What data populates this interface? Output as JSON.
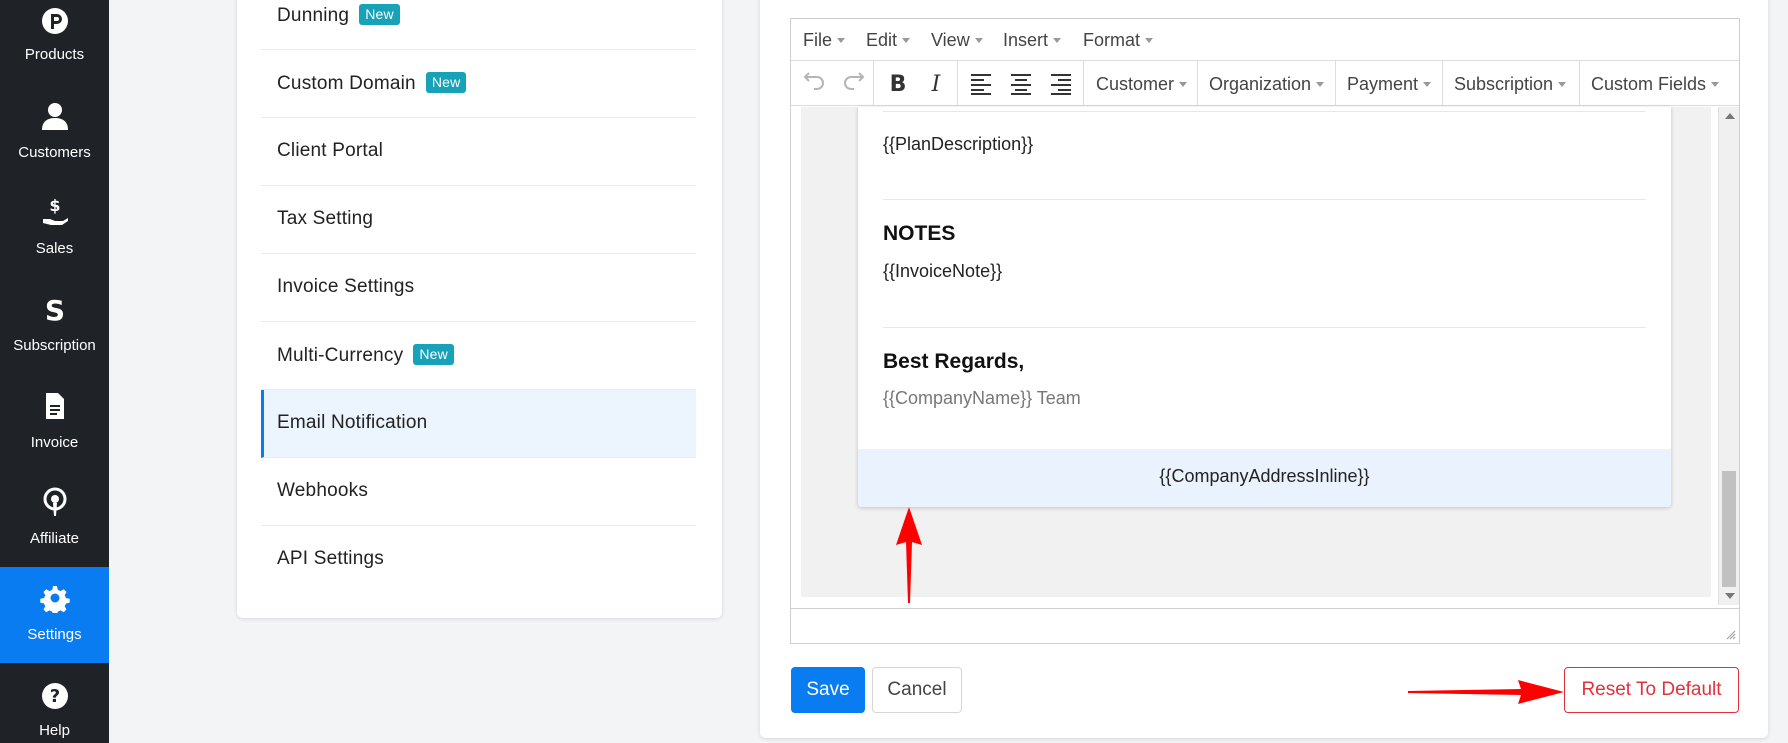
{
  "sidebar": {
    "items": [
      {
        "label": "Products",
        "icon": "products-icon"
      },
      {
        "label": "Customers",
        "icon": "customers-icon"
      },
      {
        "label": "Sales",
        "icon": "sales-icon"
      },
      {
        "label": "Subscription",
        "icon": "subscription-icon"
      },
      {
        "label": "Invoice",
        "icon": "invoice-icon"
      },
      {
        "label": "Affiliate",
        "icon": "affiliate-icon"
      },
      {
        "label": "Settings",
        "icon": "gear-icon",
        "active": true
      },
      {
        "label": "Help",
        "icon": "help-icon"
      }
    ]
  },
  "settings_menu": {
    "items": [
      {
        "label": "Dunning",
        "badge": "New"
      },
      {
        "label": "Custom Domain",
        "badge": "New"
      },
      {
        "label": "Client Portal"
      },
      {
        "label": "Tax Setting"
      },
      {
        "label": "Invoice Settings"
      },
      {
        "label": "Multi-Currency",
        "badge": "New"
      },
      {
        "label": "Email Notification",
        "active": true
      },
      {
        "label": "Webhooks"
      },
      {
        "label": "API Settings"
      }
    ]
  },
  "editor": {
    "menubar": [
      "File",
      "Edit",
      "View",
      "Insert",
      "Format"
    ],
    "toolbar": {
      "dropdowns": [
        "Customer",
        "Organization",
        "Payment",
        "Subscription",
        "Custom Fields"
      ]
    },
    "content": {
      "plan_description": "{{PlanDescription}}",
      "notes_heading": "NOTES",
      "invoice_note": "{{InvoiceNote}}",
      "regards_heading": "Best Regards,",
      "company_team": "{{CompanyName}} Team",
      "company_address": "{{CompanyAddressInline}}"
    }
  },
  "actions": {
    "save": "Save",
    "cancel": "Cancel",
    "reset": "Reset To Default"
  },
  "colors": {
    "sidebar_bg": "#1f2327",
    "accent": "#0a7cf2",
    "badge": "#17a2b8",
    "danger": "#e0323c",
    "annotation_arrow": "#ff0000"
  }
}
